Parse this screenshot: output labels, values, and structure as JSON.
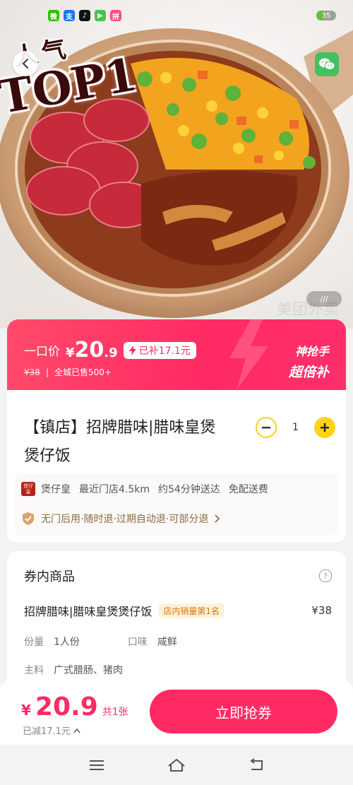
{
  "status_bar": {
    "apps": [
      {
        "name": "wechat",
        "glyph": "微",
        "color": "#2dc100"
      },
      {
        "name": "alipay",
        "glyph": "支",
        "color": "#1677ff"
      },
      {
        "name": "douyin",
        "glyph": "♪",
        "color": "#111111"
      },
      {
        "name": "iqiyi",
        "glyph": "▶",
        "color": "#4cc04c"
      },
      {
        "name": "pinduoduo",
        "glyph": "拼",
        "color": "#ff4f7a"
      }
    ],
    "battery_level": 0.35,
    "battery_text": "35"
  },
  "hero": {
    "badge_line1": "人气",
    "badge_line2": "TOP1",
    "image_counter": "///",
    "watermark": "美团外卖"
  },
  "price_banner": {
    "label": "一口价",
    "currency": "¥",
    "price_int": "20",
    "price_dec": ".9",
    "subsidy": "已补17.1元",
    "original_price": "¥38",
    "sold": "全城已售500+",
    "right_line1": "神抢手",
    "right_line2": "超倍补"
  },
  "product": {
    "title": "【镇店】招牌腊味|腊味皇煲煲仔饭",
    "quantity": "1",
    "store_logo_text": "煲仔皇",
    "store_name": "煲仔皇",
    "nearest_store": "最近门店4.5km",
    "delivery_time": "约54分钟送达",
    "delivery_fee": "免配送费",
    "guarantee": "无门后用·随时退·过期自动退·可部分退"
  },
  "goods": {
    "section_title": "券内商品",
    "item_name": "招牌腊味|腊味皇煲煲仔饭",
    "item_badge": "店内销量第1名",
    "item_price": "¥38",
    "portion_label": "份量",
    "portion_value": "1人份",
    "flavor_label": "口味",
    "flavor_value": "咸鲜",
    "main_label": "主料",
    "main_value": "广式腊肠、猪肉"
  },
  "bottom_bar": {
    "currency": "¥",
    "price": "20.9",
    "count": "共1张",
    "saved": "已减17.1元",
    "buy_label": "立即抢券"
  },
  "colors": {
    "accent": "#ff2a64",
    "yellow": "#ffd21a"
  }
}
